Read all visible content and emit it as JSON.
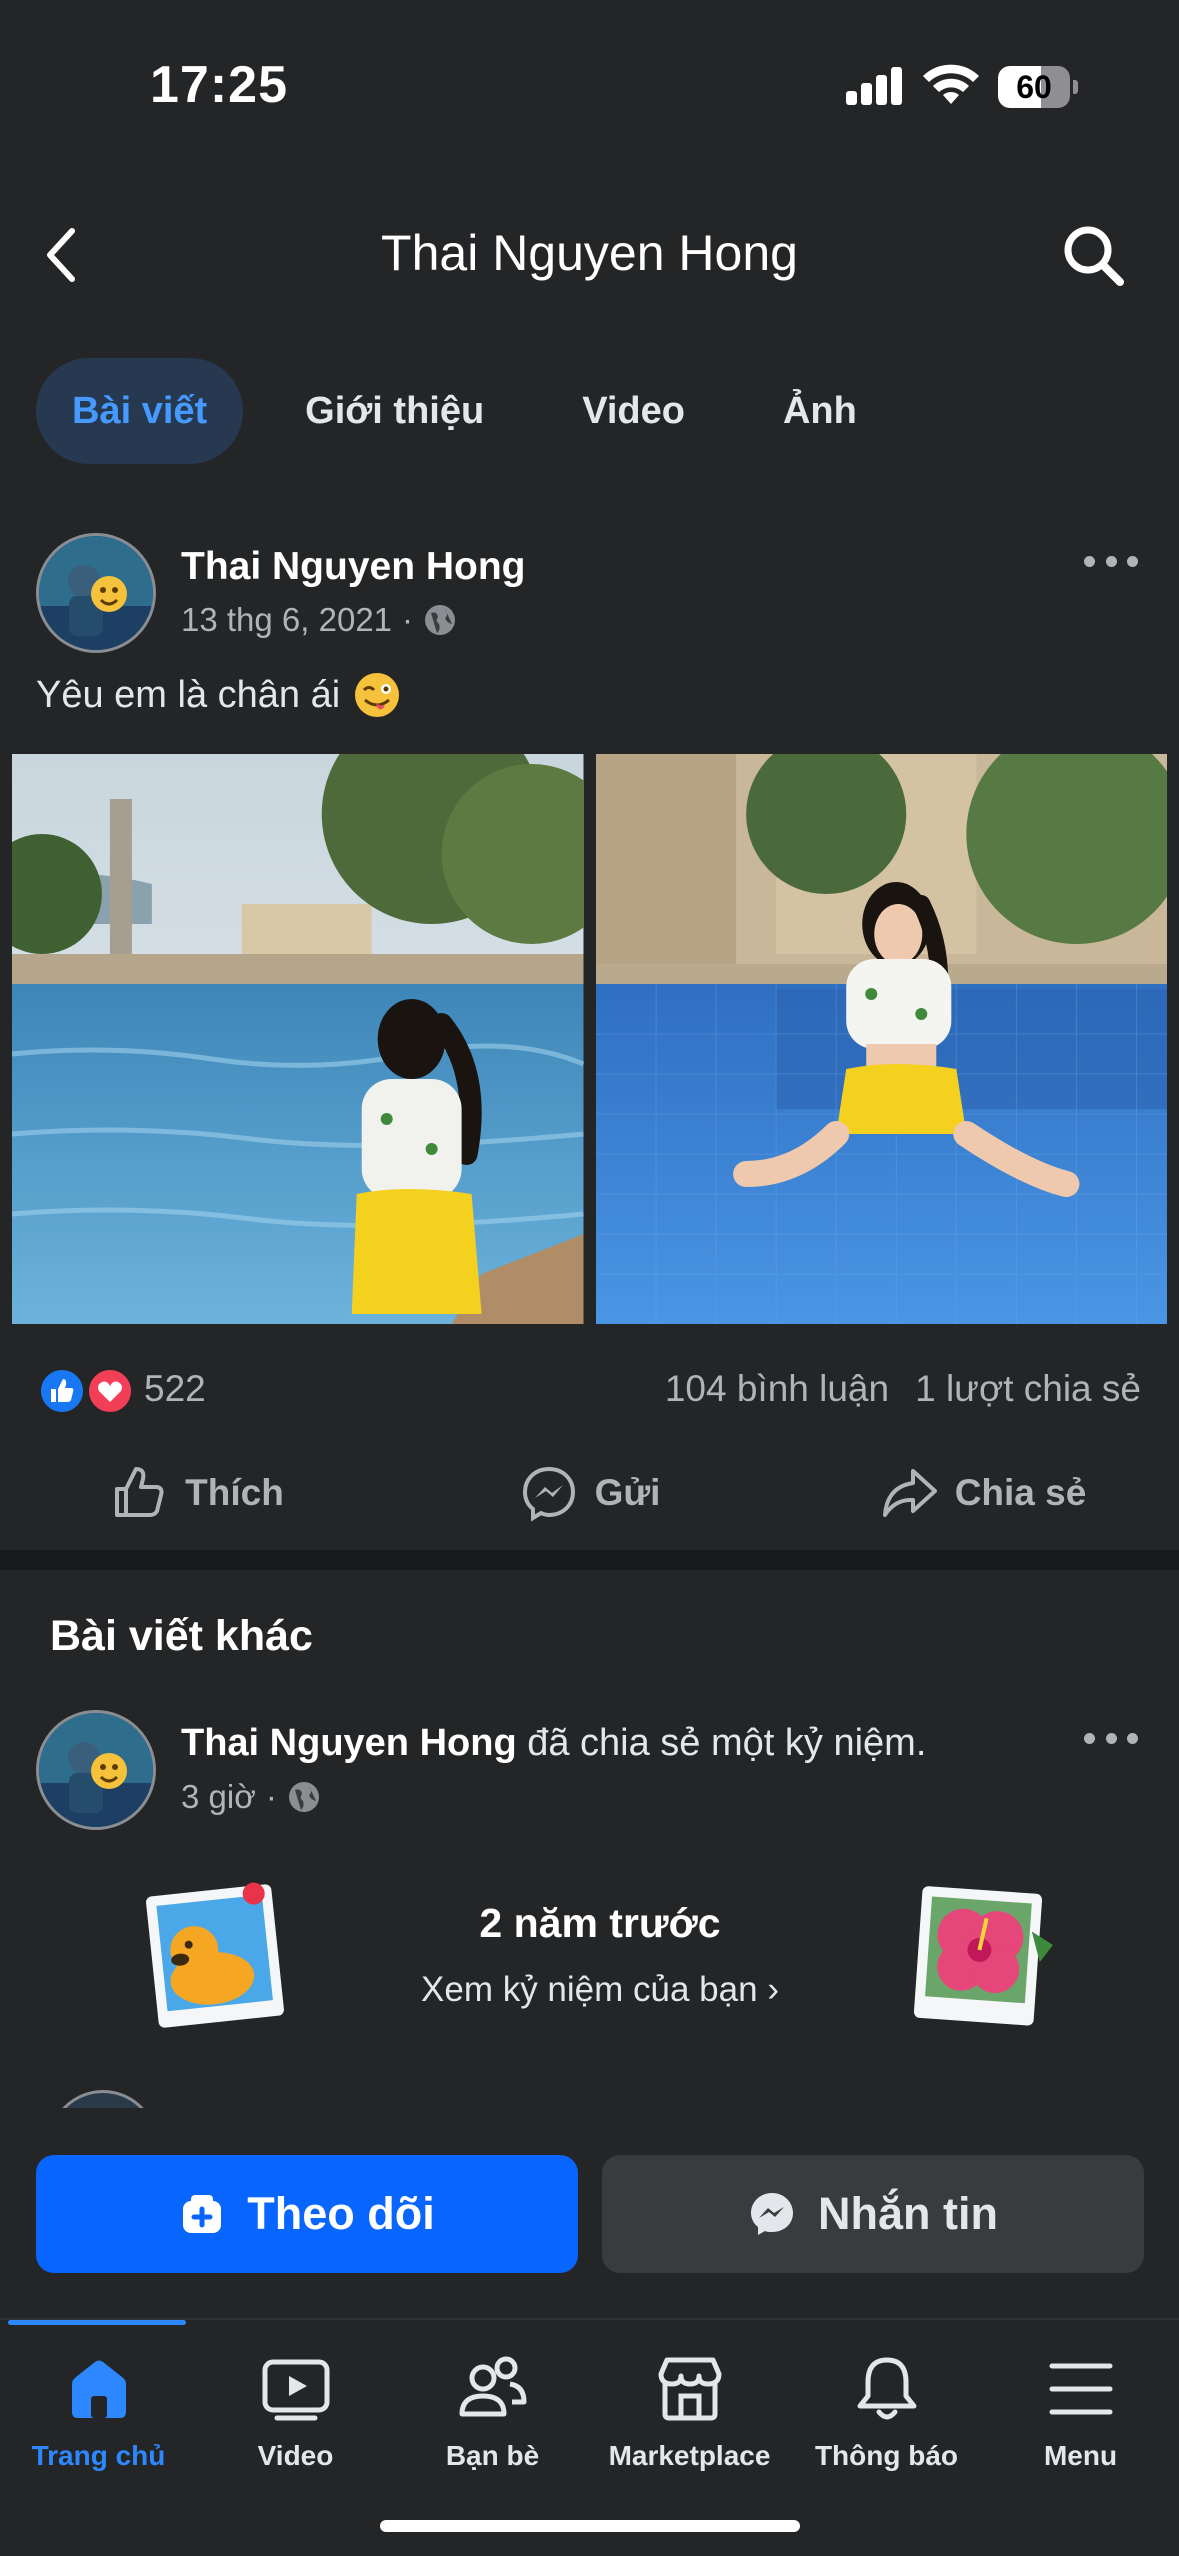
{
  "status_bar": {
    "time": "17:25",
    "battery": "60",
    "battery_level": 0.6
  },
  "header": {
    "title": "Thai Nguyen Hong"
  },
  "tabs": [
    {
      "label": "Bài viết",
      "active": true
    },
    {
      "label": "Giới thiệu"
    },
    {
      "label": "Video"
    },
    {
      "label": "Ảnh"
    }
  ],
  "post": {
    "author": "Thai Nguyen Hong",
    "date": "13 thg 6, 2021",
    "separator": "·",
    "text": "Yêu em là chân ái",
    "reaction_count": "522",
    "comments": "104 bình luận",
    "shares": "1 lượt chia sẻ",
    "actions": {
      "like": "Thích",
      "send": "Gửi",
      "share": "Chia sẻ"
    }
  },
  "section": {
    "title": "Bài viết khác"
  },
  "post2": {
    "author": "Thai Nguyen Hong",
    "action_text": "đã chia sẻ một kỷ niệm.",
    "time": "3 giờ",
    "separator": "·",
    "memory_title": "2 năm trước",
    "memory_link": "Xem kỷ niệm của bạn"
  },
  "profile_buttons": {
    "follow": "Theo dõi",
    "message": "Nhắn tin"
  },
  "bottom_nav": [
    {
      "label": "Trang chủ",
      "icon": "home-icon",
      "active": true
    },
    {
      "label": "Video",
      "icon": "video-icon"
    },
    {
      "label": "Bạn bè",
      "icon": "friends-icon"
    },
    {
      "label": "Marketplace",
      "icon": "marketplace-icon"
    },
    {
      "label": "Thông báo",
      "icon": "bell-icon"
    },
    {
      "label": "Menu",
      "icon": "menu-icon"
    }
  ],
  "colors": {
    "accent": "#0866ff",
    "link": "#2d88ff",
    "background": "#242526",
    "like": "#1877f2",
    "love": "#f33e58"
  }
}
